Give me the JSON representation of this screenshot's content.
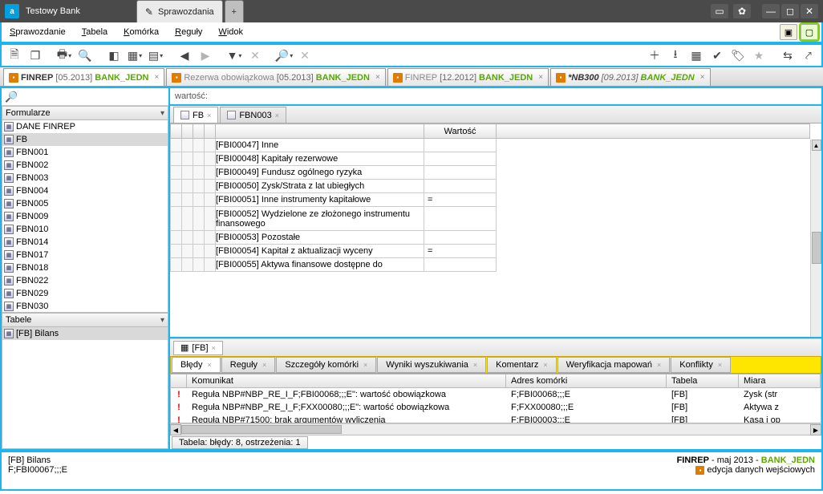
{
  "app": {
    "title": "Testowy Bank",
    "logo_letter": "a"
  },
  "window_tabs": [
    {
      "label": "Sprawozdania",
      "active": true
    }
  ],
  "menubar": [
    "Sprawozdanie",
    "Tabela",
    "Komórka",
    "Reguły",
    "Widok"
  ],
  "doc_tabs": [
    {
      "report": "FINREP",
      "date": "[05.2013]",
      "bank": "BANK_JEDN",
      "active": true
    },
    {
      "report": "Rezerwa obowiązkowa",
      "date": "[05.2013]",
      "bank": "BANK_JEDN",
      "active": false
    },
    {
      "report": "FINREP",
      "date": "[12.2012]",
      "bank": "BANK_JEDN",
      "active": false
    },
    {
      "report": "*NB300",
      "date": "[09.2013]",
      "bank": "BANK_JEDN",
      "active": false,
      "italic": true
    }
  ],
  "left": {
    "sections": {
      "formularze": "Formularze",
      "tabele": "Tabele"
    },
    "formularze_items": [
      "DANE FINREP",
      "FB",
      "FBN001",
      "FBN002",
      "FBN003",
      "FBN004",
      "FBN005",
      "FBN009",
      "FBN010",
      "FBN014",
      "FBN017",
      "FBN018",
      "FBN022",
      "FBN029",
      "FBN030"
    ],
    "formularze_selected": "FB",
    "tabele_items": [
      "[FB] Bilans"
    ]
  },
  "valbar_label": "wartość:",
  "inner_tabs": [
    {
      "label": "FB",
      "active": true
    },
    {
      "label": "FBN003",
      "active": false
    }
  ],
  "grid": {
    "value_header": "Wartość",
    "rows": [
      {
        "label": "[FBI00047] Inne",
        "indent": 2,
        "val": ""
      },
      {
        "label": "[FBI00048] Kapitały rezerwowe",
        "indent": 1,
        "val": ""
      },
      {
        "label": "[FBI00049] Fundusz ogólnego ryzyka",
        "indent": 1,
        "val": ""
      },
      {
        "label": "[FBI00050] Zysk/Strata z lat ubiegłych",
        "indent": 1,
        "val": ""
      },
      {
        "label": "[FBI00051] Inne instrumenty kapitałowe",
        "indent": 1,
        "val": "="
      },
      {
        "label": "[FBI00052] Wydzielone ze złożonego instrumentu finansowego",
        "indent": 2,
        "val": "",
        "tall": true
      },
      {
        "label": "[FBI00053] Pozostałe",
        "indent": 2,
        "val": ""
      },
      {
        "label": "[FBI00054] Kapitał z aktualizacji wyceny",
        "indent": 1,
        "val": "="
      },
      {
        "label": "[FBI00055] Aktywa finansowe dostępne do",
        "indent": 2,
        "val": ""
      }
    ],
    "crumb": "[FB]"
  },
  "bottom_tabs": [
    "Błędy",
    "Reguły",
    "Szczegóły komórki",
    "Wyniki wyszukiwania",
    "Komentarz",
    "Weryfikacja mapowań",
    "Konflikty"
  ],
  "bottom_active": "Błędy",
  "messages": {
    "columns": [
      "Komunikat",
      "Adres komórki",
      "Tabela",
      "Miara"
    ],
    "rows": [
      {
        "msg": "Reguła NBP#NBP_RE_I_F;FBI00068;;;E\": wartość obowiązkowa",
        "addr": "F;FBI00068;;;E",
        "tab": "[FB]",
        "miara": "Zysk (str"
      },
      {
        "msg": "Reguła NBP#NBP_RE_I_F;FXX00080;;;E\": wartość obowiązkowa",
        "addr": "F;FXX00080;;;E",
        "tab": "[FB]",
        "miara": "Aktywa z"
      },
      {
        "msg": "Reguła NBP#71500: brak argumentów wyliczenia",
        "addr": "F;FBI00003;;;E",
        "tab": "[FB]",
        "miara": "Kasa i op"
      }
    ]
  },
  "status_mini": "Tabela: błędy: 8, ostrzeżenia: 1",
  "footer": {
    "left1": "[FB] Bilans",
    "left2": "F;FBI00067;;;E",
    "right_report": "FINREP",
    "right_sep": " - ",
    "right_month": "maj 2013",
    "right_bank": "BANK_JEDN",
    "right_note": "edycja danych wejściowych"
  }
}
